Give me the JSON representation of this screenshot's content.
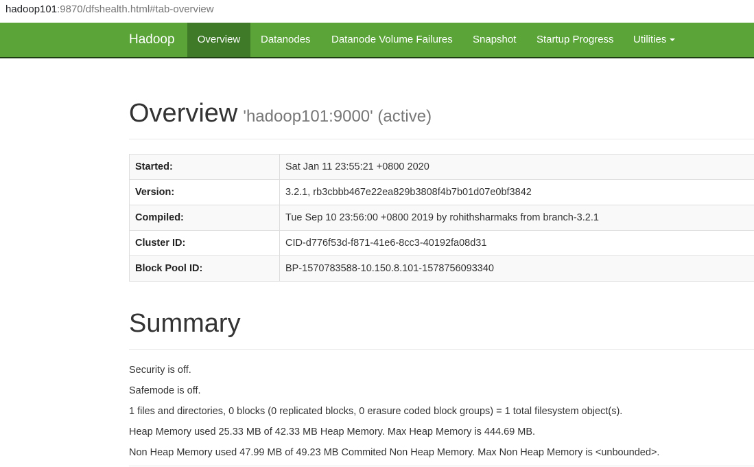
{
  "browser": {
    "url_host": "hadoop101",
    "url_rest": ":9870/dfshealth.html#tab-overview"
  },
  "navbar": {
    "brand": "Hadoop",
    "items": [
      {
        "label": "Overview",
        "active": true
      },
      {
        "label": "Datanodes"
      },
      {
        "label": "Datanode Volume Failures"
      },
      {
        "label": "Snapshot"
      },
      {
        "label": "Startup Progress"
      },
      {
        "label": "Utilities"
      }
    ]
  },
  "overview": {
    "title": "Overview",
    "subtitle": "'hadoop101:9000' (active)",
    "rows": [
      {
        "label": "Started:",
        "value": "Sat Jan 11 23:55:21 +0800 2020"
      },
      {
        "label": "Version:",
        "value": "3.2.1, rb3cbbb467e22ea829b3808f4b7b01d07e0bf3842"
      },
      {
        "label": "Compiled:",
        "value": "Tue Sep 10 23:56:00 +0800 2019 by rohithsharmaks from branch-3.2.1"
      },
      {
        "label": "Cluster ID:",
        "value": "CID-d776f53d-f871-41e6-8cc3-40192fa08d31"
      },
      {
        "label": "Block Pool ID:",
        "value": "BP-1570783588-10.150.8.101-1578756093340"
      }
    ]
  },
  "summary": {
    "title": "Summary",
    "lines": [
      "Security is off.",
      "Safemode is off.",
      "1 files and directories, 0 blocks (0 replicated blocks, 0 erasure coded block groups) = 1 total filesystem object(s).",
      "Heap Memory used 25.33 MB of 42.33 MB Heap Memory. Max Heap Memory is 444.69 MB.",
      "Non Heap Memory used 47.99 MB of 49.23 MB Commited Non Heap Memory. Max Non Heap Memory is <unbounded>."
    ]
  },
  "colors": {
    "navbar_bg": "#5aa438",
    "navbar_active_bg": "#3f7a29"
  }
}
